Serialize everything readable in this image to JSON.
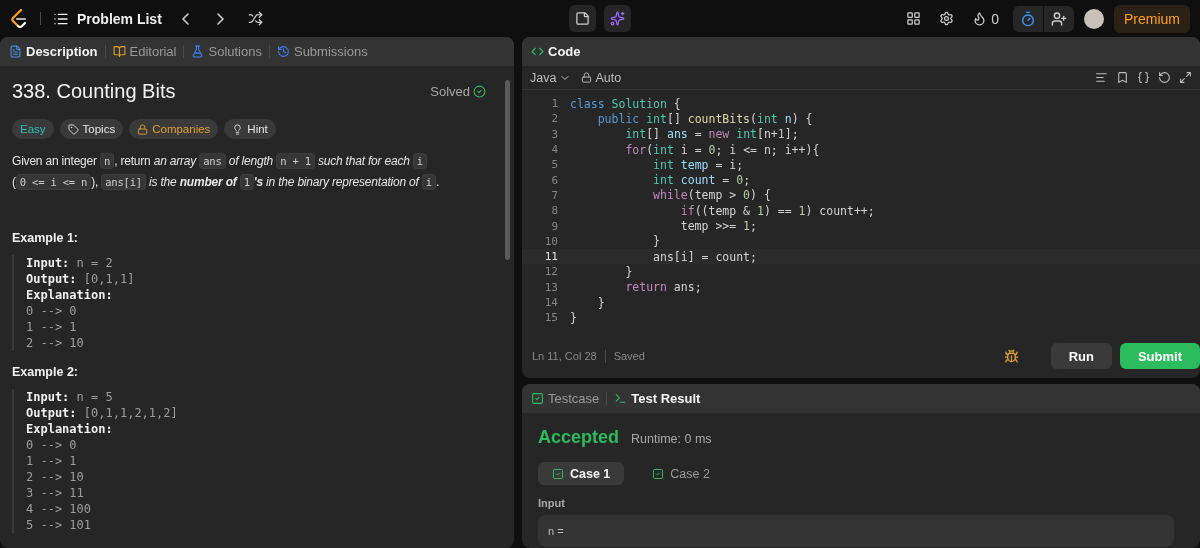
{
  "topbar": {
    "nav_title": "Problem List",
    "streak": "0",
    "timer_active": true,
    "premium": "Premium"
  },
  "left_tabs": [
    {
      "label": "Description",
      "kind": "description",
      "selected": true
    },
    {
      "label": "Editorial",
      "kind": "editorial",
      "selected": false
    },
    {
      "label": "Solutions",
      "kind": "solutions",
      "selected": false
    },
    {
      "label": "Submissions",
      "kind": "submissions",
      "selected": false
    }
  ],
  "problem": {
    "title": "338. Counting Bits",
    "status": "Solved",
    "solved": true,
    "tags": [
      {
        "label": "Easy",
        "kind": "difficulty"
      },
      {
        "label": "Topics",
        "kind": "topics"
      },
      {
        "label": "Companies",
        "kind": "companies"
      },
      {
        "label": "Hint",
        "kind": "hint"
      }
    ],
    "description": [
      {
        "kind": "text",
        "text": "Given an integer "
      },
      {
        "kind": "code",
        "text": "n"
      },
      {
        "kind": "text",
        "text": ", return "
      },
      {
        "kind": "italic",
        "text": "an array "
      },
      {
        "kind": "code",
        "text": "ans"
      },
      {
        "kind": "italic",
        "text": " of length "
      },
      {
        "kind": "code",
        "text": "n + 1"
      },
      {
        "kind": "italic",
        "text": " such that for each "
      },
      {
        "kind": "code",
        "text": "i"
      },
      {
        "kind": "text",
        "text": " ("
      },
      {
        "kind": "code",
        "text": "0 <= i <= n"
      },
      {
        "kind": "text",
        "text": "), "
      },
      {
        "kind": "code",
        "text": "ans[i]"
      },
      {
        "kind": "italic",
        "text": " is the "
      },
      {
        "kind": "bolditalic",
        "text": "number of "
      },
      {
        "kind": "code",
        "text": "1"
      },
      {
        "kind": "bolditalic",
        "text": "'s"
      },
      {
        "kind": "italic",
        "text": " in the binary representation of "
      },
      {
        "kind": "code",
        "text": "i"
      },
      {
        "kind": "text",
        "text": "."
      }
    ],
    "examples": [
      {
        "title": "Example 1:",
        "lines": [
          {
            "label": "Input:",
            "value": "n = 2"
          },
          {
            "label": "Output:",
            "value": "[0,1,1]"
          },
          {
            "label": "Explanation:"
          },
          {
            "value": "0 --> 0"
          },
          {
            "value": "1 --> 1"
          },
          {
            "value": "2 --> 10"
          }
        ]
      },
      {
        "title": "Example 2:",
        "lines": [
          {
            "label": "Input:",
            "value": "n = 5"
          },
          {
            "label": "Output:",
            "value": "[0,1,1,2,1,2]"
          },
          {
            "label": "Explanation:"
          },
          {
            "value": "0 --> 0"
          },
          {
            "value": "1 --> 1"
          },
          {
            "value": "2 --> 10"
          },
          {
            "value": "3 --> 11"
          },
          {
            "value": "4 --> 100"
          },
          {
            "value": "5 --> 101"
          }
        ]
      }
    ]
  },
  "editor": {
    "tab": "Code",
    "language": "Java",
    "mode": "Auto",
    "status": "Ln 11, Col 28",
    "save_state": "Saved",
    "run": "Run",
    "submit": "Submit",
    "lines": [
      {
        "number": "1",
        "current": false,
        "tokens": [
          {
            "kind": "decl",
            "text": "class "
          },
          {
            "kind": "type",
            "text": "Solution"
          },
          {
            "kind": "plain",
            "text": " {"
          }
        ]
      },
      {
        "number": "2",
        "current": false,
        "tokens": [
          {
            "kind": "decl",
            "text": "    public "
          },
          {
            "kind": "type",
            "text": "int"
          },
          {
            "kind": "plain",
            "text": "[] "
          },
          {
            "kind": "func",
            "text": "countBits"
          },
          {
            "kind": "plain",
            "text": "("
          },
          {
            "kind": "type",
            "text": "int "
          },
          {
            "kind": "var",
            "text": "n"
          },
          {
            "kind": "plain",
            "text": ") {"
          }
        ]
      },
      {
        "number": "3",
        "current": false,
        "tokens": [
          {
            "kind": "type",
            "text": "        int"
          },
          {
            "kind": "plain",
            "text": "[] "
          },
          {
            "kind": "var",
            "text": "ans"
          },
          {
            "kind": "plain",
            "text": " = "
          },
          {
            "kind": "keyword",
            "text": "new "
          },
          {
            "kind": "type",
            "text": "int"
          },
          {
            "kind": "plain",
            "text": "[n+"
          },
          {
            "kind": "number",
            "text": "1"
          },
          {
            "kind": "plain",
            "text": "];"
          }
        ]
      },
      {
        "number": "4",
        "current": false,
        "tokens": [
          {
            "kind": "keyword",
            "text": "        for"
          },
          {
            "kind": "plain",
            "text": "("
          },
          {
            "kind": "type",
            "text": "int "
          },
          {
            "kind": "plain",
            "text": "i = "
          },
          {
            "kind": "number",
            "text": "0"
          },
          {
            "kind": "plain",
            "text": "; i <= n; i++){"
          }
        ]
      },
      {
        "number": "5",
        "current": false,
        "tokens": [
          {
            "kind": "type",
            "text": "            int "
          },
          {
            "kind": "var",
            "text": "temp"
          },
          {
            "kind": "plain",
            "text": " = i;"
          }
        ]
      },
      {
        "number": "6",
        "current": false,
        "tokens": [
          {
            "kind": "type",
            "text": "            int "
          },
          {
            "kind": "var",
            "text": "count"
          },
          {
            "kind": "plain",
            "text": " = "
          },
          {
            "kind": "number",
            "text": "0"
          },
          {
            "kind": "plain",
            "text": ";"
          }
        ]
      },
      {
        "number": "7",
        "current": false,
        "tokens": [
          {
            "kind": "keyword",
            "text": "            while"
          },
          {
            "kind": "plain",
            "text": "(temp > "
          },
          {
            "kind": "number",
            "text": "0"
          },
          {
            "kind": "plain",
            "text": ") {"
          }
        ]
      },
      {
        "number": "8",
        "current": false,
        "tokens": [
          {
            "kind": "keyword",
            "text": "                if"
          },
          {
            "kind": "plain",
            "text": "((temp & "
          },
          {
            "kind": "number",
            "text": "1"
          },
          {
            "kind": "plain",
            "text": ") == "
          },
          {
            "kind": "number",
            "text": "1"
          },
          {
            "kind": "plain",
            "text": ") count++;"
          }
        ]
      },
      {
        "number": "9",
        "current": false,
        "tokens": [
          {
            "kind": "plain",
            "text": "                temp >>= "
          },
          {
            "kind": "number",
            "text": "1"
          },
          {
            "kind": "plain",
            "text": ";"
          }
        ]
      },
      {
        "number": "10",
        "current": false,
        "tokens": [
          {
            "kind": "plain",
            "text": "            }"
          }
        ]
      },
      {
        "number": "11",
        "current": true,
        "tokens": [
          {
            "kind": "plain",
            "text": "            ans[i] = count;"
          }
        ]
      },
      {
        "number": "12",
        "current": false,
        "tokens": [
          {
            "kind": "plain",
            "text": "        }"
          }
        ]
      },
      {
        "number": "13",
        "current": false,
        "tokens": [
          {
            "kind": "keyword",
            "text": "        return "
          },
          {
            "kind": "plain",
            "text": "ans;"
          }
        ]
      },
      {
        "number": "14",
        "current": false,
        "tokens": [
          {
            "kind": "plain",
            "text": "    }"
          }
        ]
      },
      {
        "number": "15",
        "current": false,
        "tokens": [
          {
            "kind": "plain",
            "text": "}"
          }
        ]
      }
    ]
  },
  "results": {
    "tabs": [
      {
        "label": "Testcase",
        "kind": "testcase",
        "selected": false
      },
      {
        "label": "Test Result",
        "kind": "result",
        "selected": true
      }
    ],
    "verdict": "Accepted",
    "runtime": "Runtime: 0 ms",
    "cases": [
      {
        "label": "Case 1",
        "selected": true,
        "passed": true
      },
      {
        "label": "Case 2",
        "selected": false,
        "passed": true
      }
    ],
    "input_label": "Input",
    "input_value": "n ="
  }
}
